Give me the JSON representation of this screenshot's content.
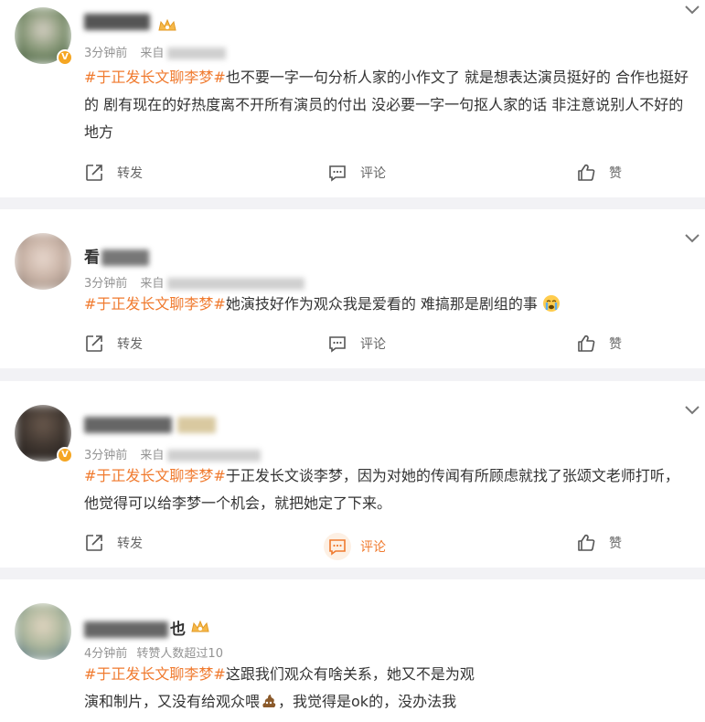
{
  "posts": [
    {
      "name_visible": "",
      "time": "3分钟前",
      "source_prefix": "来自",
      "tag": "#于正发长文聊李梦#",
      "text": "也不要一字一句分析人家的小作文了 就是想表达演员挺好的 合作也挺好的 剧有现在的好热度离不开所有演员的付出 没必要一字一句抠人家的话 非注意说别人不好的地方",
      "share": "转发",
      "comment": "评论",
      "like": "赞"
    },
    {
      "name_visible": "看",
      "time": "3分钟前",
      "source_prefix": "来自",
      "tag": "#于正发长文聊李梦#",
      "text": "她演技好作为观众我是爱看的 难搞那是剧组的事",
      "share": "转发",
      "comment": "评论",
      "like": "赞"
    },
    {
      "name_visible": "",
      "time": "3分钟前",
      "source_prefix": "来自",
      "tag": "#于正发长文聊李梦#",
      "text": "于正发长文谈李梦，因为对她的传闻有所顾虑就找了张颂文老师打听，他觉得可以给李梦一个机会，就把她定了下来。",
      "share": "转发",
      "comment": "评论",
      "like": "赞"
    },
    {
      "name_visible": "也",
      "time": "4分钟前",
      "source_prefix": "转赞人数超过10",
      "tag": "#于正发长文聊李梦#",
      "text_line1": "这跟我们观众有啥关系，她又不是为观",
      "text_line2_a": "演和制片，又没有给观众喂",
      "text_line2_b": "，我觉得是ok的，没办法我",
      "share": "",
      "comment": "",
      "like": ""
    }
  ],
  "colors": {
    "tag": "#f07a2e",
    "text": "#333333",
    "meta": "#939393",
    "background": "#f2f2f5",
    "badge": "#f5a623"
  },
  "icons": [
    "share-icon",
    "comment-icon",
    "like-icon",
    "chevron-down-icon",
    "crown-icon",
    "verified-badge-icon",
    "crying-emoji",
    "poop-emoji"
  ]
}
